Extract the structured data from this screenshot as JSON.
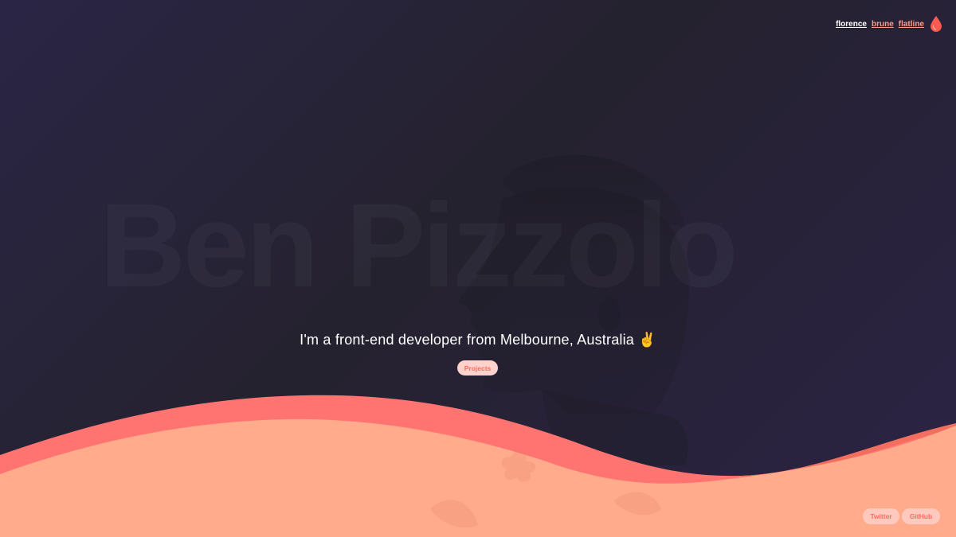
{
  "nav": {
    "themes": [
      {
        "label": "florence",
        "state": "active"
      },
      {
        "label": "brune",
        "state": "inactive"
      },
      {
        "label": "flatline",
        "state": "inactive"
      }
    ],
    "theme_icon": "drop-icon",
    "accent": "#ff5a4f"
  },
  "hero": {
    "background_name": "Ben Pizzolo",
    "tagline": "I'm a front-end developer from Melbourne, Australia ✌️",
    "projects_label": "Projects"
  },
  "footer": {
    "twitter_label": "Twitter",
    "github_label": "GitHub"
  },
  "colors": {
    "background": "#28243a",
    "wave_front": "#ffab8c",
    "wave_back": "#ff7470",
    "button_bg": "#ffd3cc",
    "button_text": "#ff6b63"
  }
}
